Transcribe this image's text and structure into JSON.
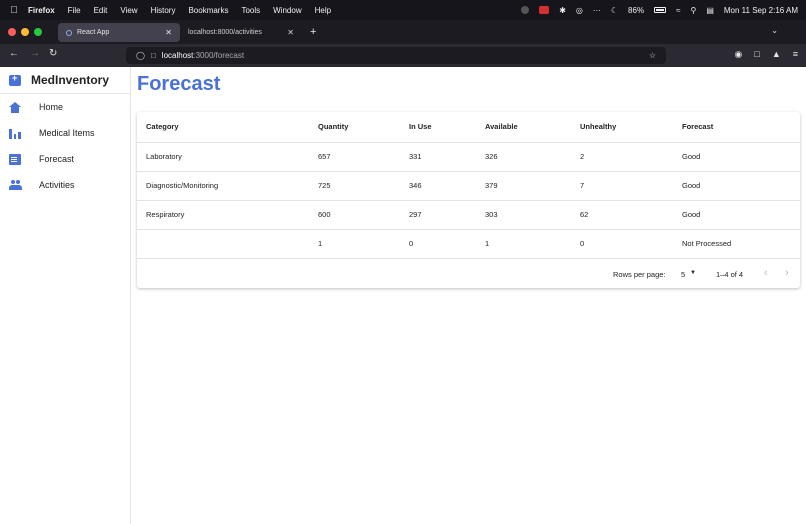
{
  "menubar": {
    "app_name": "Firefox",
    "items": [
      "File",
      "Edit",
      "View",
      "History",
      "Bookmarks",
      "Tools",
      "Window",
      "Help"
    ],
    "battery": "86%",
    "datetime": "Mon 11 Sep  2:16 AM"
  },
  "browser": {
    "tabs": [
      {
        "label": "React App",
        "active": true
      },
      {
        "label": "localhost:8000/activities",
        "active": false
      }
    ],
    "url_host": "localhost",
    "url_path": ":3000/forecast"
  },
  "app": {
    "brand": "MedInventory",
    "nav": [
      {
        "label": "Home",
        "icon": "home-icon"
      },
      {
        "label": "Medical Items",
        "icon": "bar-chart-icon"
      },
      {
        "label": "Forecast",
        "icon": "document-icon"
      },
      {
        "label": "Activities",
        "icon": "people-icon"
      }
    ],
    "page_title": "Forecast",
    "table": {
      "headers": [
        "Category",
        "Quantity",
        "In Use",
        "Available",
        "Unhealthy",
        "Forecast"
      ],
      "rows": [
        [
          "Laboratory",
          "657",
          "331",
          "326",
          "2",
          "Good"
        ],
        [
          "Diagnostic/Monitoring",
          "725",
          "346",
          "379",
          "7",
          "Good"
        ],
        [
          "Respiratory",
          "600",
          "297",
          "303",
          "62",
          "Good"
        ],
        [
          "",
          "1",
          "0",
          "1",
          "0",
          "Not Processed"
        ]
      ]
    },
    "pagination": {
      "rows_per_page_label": "Rows per page:",
      "rows_per_page": "5",
      "range": "1–4 of 4"
    }
  },
  "colors": {
    "accent": "#4a72d6",
    "browser_bg": "#1c1b22"
  }
}
